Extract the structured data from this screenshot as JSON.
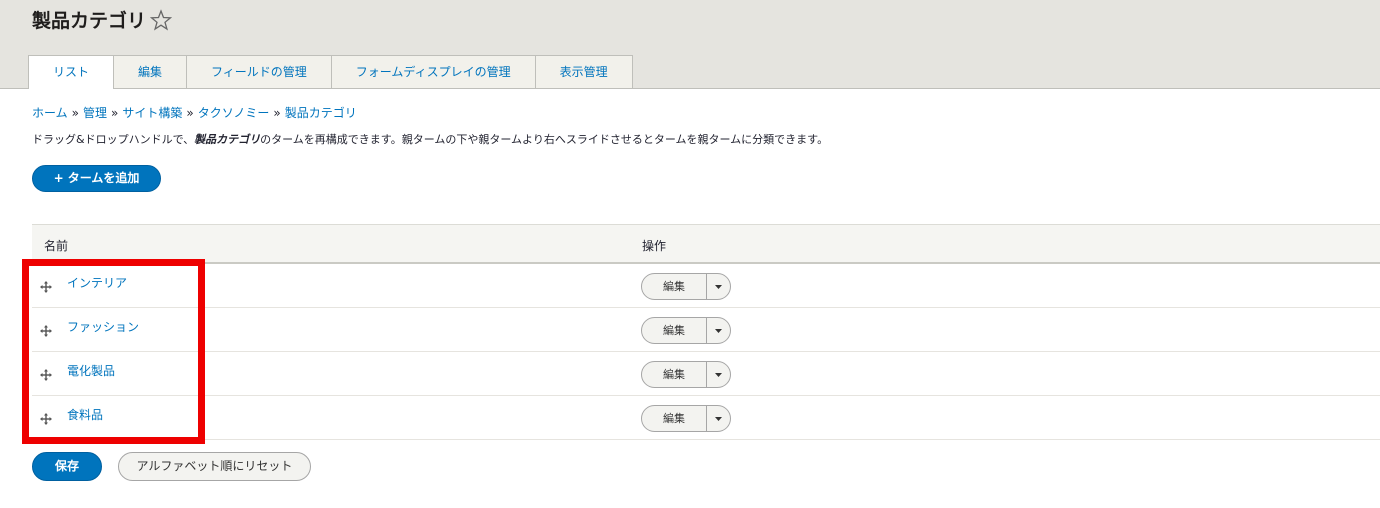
{
  "header": {
    "title": "製品カテゴリ",
    "tabs": [
      {
        "label": "リスト",
        "active": true
      },
      {
        "label": "編集",
        "active": false
      },
      {
        "label": "フィールドの管理",
        "active": false
      },
      {
        "label": "フォームディスプレイの管理",
        "active": false
      },
      {
        "label": "表示管理",
        "active": false
      }
    ]
  },
  "breadcrumb": [
    "ホーム",
    "管理",
    "サイト構築",
    "タクソノミー",
    "製品カテゴリ"
  ],
  "breadcrumb_separator": "»",
  "help": {
    "before": "ドラッグ&ドロップハンドルで、",
    "emphasis": "製品カテゴリ",
    "after": "のタームを再構成できます。親タームの下や親タームより右へスライドさせるとタームを親タームに分類できます。"
  },
  "add_term_button": "+ タームを追加",
  "table": {
    "headers": {
      "name": "名前",
      "operations": "操作"
    },
    "rows": [
      {
        "name": "インテリア",
        "operation": "編集"
      },
      {
        "name": "ファッション",
        "operation": "編集"
      },
      {
        "name": "電化製品",
        "operation": "編集"
      },
      {
        "name": "食料品",
        "operation": "編集"
      }
    ]
  },
  "save_button": "保存",
  "reset_button": "アルファベット順にリセット",
  "colors": {
    "accent": "#0074bd",
    "header_bg": "#e5e4df",
    "highlight": "#ee0000"
  },
  "icons": {
    "favorite": "star-icon",
    "drag": "drag-handle-icon",
    "dropdown": "caret-down-icon"
  }
}
